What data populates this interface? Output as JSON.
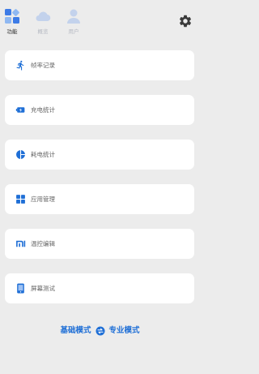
{
  "tabs": [
    {
      "label": "功能",
      "icon": "grid-icon",
      "active": true
    },
    {
      "label": "概览",
      "icon": "cloud-icon",
      "active": false
    },
    {
      "label": "用户",
      "icon": "user-icon",
      "active": false
    }
  ],
  "settings_icon": "gear-icon",
  "menu": [
    {
      "label": "帧率记录",
      "icon": "running-icon"
    },
    {
      "label": "充电统计",
      "icon": "battery-charging-icon"
    },
    {
      "label": "耗电统计",
      "icon": "pie-chart-icon"
    },
    {
      "label": "应用管理",
      "icon": "apps-grid-icon"
    },
    {
      "label": "温控编辑",
      "icon": "mi-logo-icon"
    },
    {
      "label": "屏幕测试",
      "icon": "phone-screen-icon"
    }
  ],
  "mode_switch": {
    "left_label": "基础模式",
    "right_label": "专业模式",
    "icon": "swap-icon"
  },
  "colors": {
    "accent": "#1f6fd6",
    "background": "#ececec",
    "card": "#ffffff",
    "inactive_tab": "#b5b9c2"
  }
}
